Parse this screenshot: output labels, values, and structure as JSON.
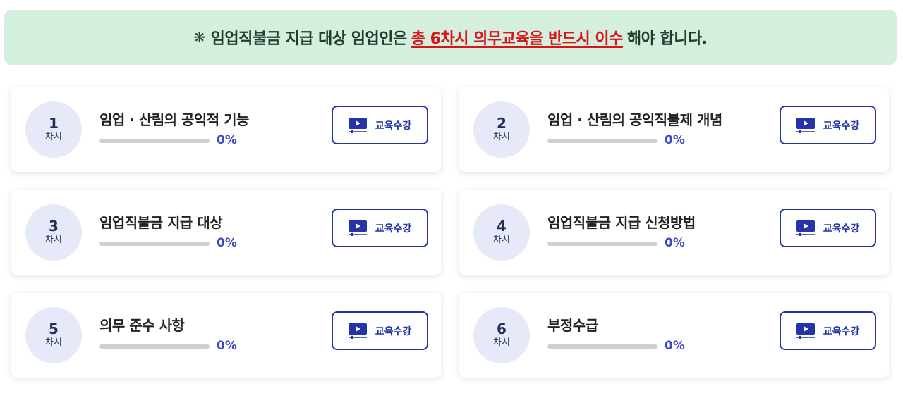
{
  "notice": {
    "mark": "❋",
    "prefix": "임업직불금 지급 대상 임업인은",
    "highlight": "총 6차시 의무교육을 반드시 이수",
    "suffix": "해야 합니다."
  },
  "lessons": [
    {
      "num": "1",
      "unit": "차시",
      "title": "임업 · 산림의 공익적 기능",
      "progress": 0,
      "progress_label": "0%",
      "button_label": "교육수강",
      "button_icon": "video-play-icon"
    },
    {
      "num": "2",
      "unit": "차시",
      "title": "임업 · 산림의 공익직불제 개념",
      "progress": 0,
      "progress_label": "0%",
      "button_label": "교육수강",
      "button_icon": "video-play-icon"
    },
    {
      "num": "3",
      "unit": "차시",
      "title": "임업직불금 지급 대상",
      "progress": 0,
      "progress_label": "0%",
      "button_label": "교육수강",
      "button_icon": "video-play-icon"
    },
    {
      "num": "4",
      "unit": "차시",
      "title": "임업직불금 지급 신청방법",
      "progress": 0,
      "progress_label": "0%",
      "button_label": "교육수강",
      "button_icon": "video-play-icon"
    },
    {
      "num": "5",
      "unit": "차시",
      "title": "의무 준수 사항",
      "progress": 0,
      "progress_label": "0%",
      "button_label": "교육수강",
      "button_icon": "video-play-icon"
    },
    {
      "num": "6",
      "unit": "차시",
      "title": "부정수급",
      "progress": 0,
      "progress_label": "0%",
      "button_label": "교육수강",
      "button_icon": "video-play-icon"
    }
  ],
  "colors": {
    "banner_bg": "#d5efdf",
    "highlight": "#d8141b",
    "accent": "#2533a8",
    "progress": "#3b46c4",
    "badge_bg": "#e6e9f7"
  }
}
